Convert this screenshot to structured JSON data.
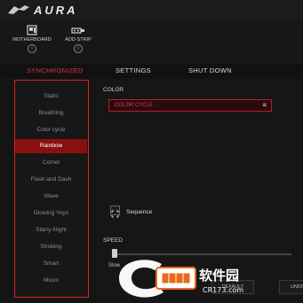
{
  "app": {
    "title": "AURA",
    "bg_text": ""
  },
  "devices": [
    {
      "label": "MOTHERBOARD",
      "icon": "motherboard-icon"
    },
    {
      "label": "ADD-STRIP",
      "icon": "led-strip-icon"
    }
  ],
  "tabs": [
    {
      "label": "SYNCHRONIZED",
      "active": true
    },
    {
      "label": "SETTINGS",
      "active": false
    },
    {
      "label": "SHUT DOWN",
      "active": false
    }
  ],
  "sidebar": {
    "items": [
      {
        "label": "Static"
      },
      {
        "label": "Breathing"
      },
      {
        "label": "Color cycle"
      },
      {
        "label": "Rainbow",
        "active": true
      },
      {
        "label": "Comet"
      },
      {
        "label": "Flash and Dash"
      },
      {
        "label": "Wave"
      },
      {
        "label": "Glowing Yoyo"
      },
      {
        "label": "Starry-Night"
      },
      {
        "label": "Strobing"
      },
      {
        "label": "Smart"
      },
      {
        "label": "Music"
      }
    ]
  },
  "color": {
    "label": "COLOR",
    "select_value": "COLOR CYCLE"
  },
  "sequence": {
    "label": "Sequence"
  },
  "speed": {
    "label": "SPEED",
    "slow_label": "Slow",
    "level": 0.0
  },
  "footer": {
    "default_label": "DEFAULT",
    "undo_label": "UNDO"
  },
  "watermark": {
    "text_main": "软件园",
    "text_url": "CR173.com"
  },
  "colors": {
    "accent": "#d8232a",
    "active_item_bg": "#8a1010",
    "window_bg": "#141414"
  }
}
